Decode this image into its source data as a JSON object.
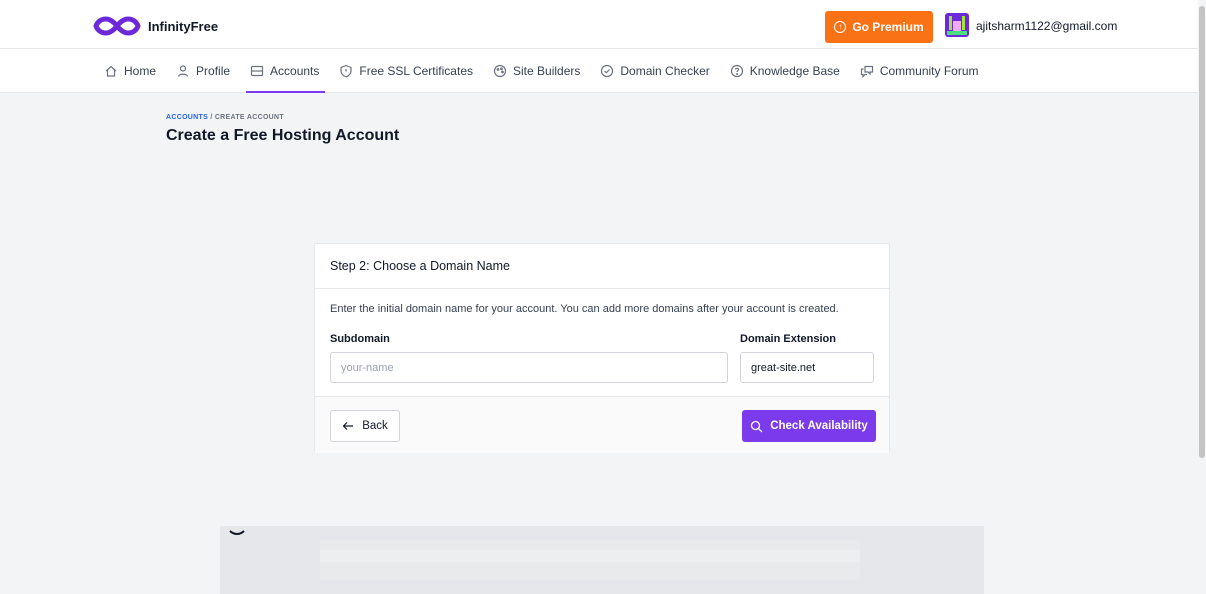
{
  "brand": {
    "name": "InfinityFree",
    "accent": "#7c3aed",
    "premium_color": "#f97316"
  },
  "header": {
    "premium_label": "Go Premium",
    "user_email": "ajitsharm1122@gmail.com"
  },
  "nav": {
    "items": [
      {
        "label": "Home",
        "icon": "home-icon"
      },
      {
        "label": "Profile",
        "icon": "user-icon"
      },
      {
        "label": "Accounts",
        "icon": "server-icon",
        "active": true
      },
      {
        "label": "Free SSL Certificates",
        "icon": "shield-icon"
      },
      {
        "label": "Site Builders",
        "icon": "palette-icon"
      },
      {
        "label": "Domain Checker",
        "icon": "check-circle-icon"
      },
      {
        "label": "Knowledge Base",
        "icon": "help-circle-icon"
      },
      {
        "label": "Community Forum",
        "icon": "chat-icon"
      }
    ]
  },
  "breadcrumb": {
    "first": "ACCOUNTS",
    "separator": "/",
    "current": "CREATE ACCOUNT"
  },
  "page": {
    "title": "Create a Free Hosting Account"
  },
  "card": {
    "title": "Step 2: Choose a Domain Name",
    "intro": "Enter the initial domain name for your account. You can add more domains after your account is created.",
    "subdomain_label": "Subdomain",
    "subdomain_placeholder": "your-name",
    "subdomain_value": "",
    "extension_label": "Domain Extension",
    "extension_value": "great-site.net",
    "back_label": "Back",
    "check_label": "Check Availability"
  }
}
